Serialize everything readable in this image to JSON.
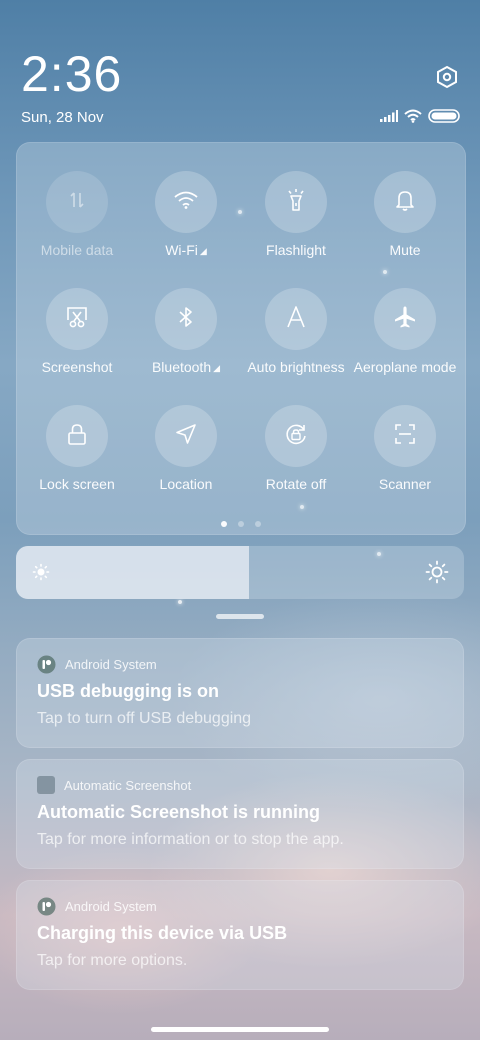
{
  "status": {
    "time": "2:36",
    "date": "Sun, 28 Nov"
  },
  "icons": {
    "settings": "settings-hexagon-icon",
    "signal": "cellular-signal-icon",
    "wifi": "wifi-status-icon",
    "battery": "battery-icon"
  },
  "quick_settings": {
    "tiles": [
      {
        "label": "Mobile data",
        "icon": "mobile-data-icon",
        "enabled": false
      },
      {
        "label": "Wi-Fi",
        "icon": "wifi-icon",
        "enabled": true
      },
      {
        "label": "Flashlight",
        "icon": "flashlight-icon",
        "enabled": true
      },
      {
        "label": "Mute",
        "icon": "bell-icon",
        "enabled": true
      },
      {
        "label": "Screenshot",
        "icon": "screenshot-scissors-icon",
        "enabled": true
      },
      {
        "label": "Bluetooth",
        "icon": "bluetooth-icon",
        "enabled": true
      },
      {
        "label": "Auto brightness",
        "icon": "auto-brightness-icon",
        "enabled": true
      },
      {
        "label": "Aeroplane mode",
        "icon": "airplane-icon",
        "enabled": true
      },
      {
        "label": "Lock screen",
        "icon": "lock-icon",
        "enabled": true
      },
      {
        "label": "Location",
        "icon": "location-arrow-icon",
        "enabled": true
      },
      {
        "label": "Rotate off",
        "icon": "rotate-lock-icon",
        "enabled": true
      },
      {
        "label": "Scanner",
        "icon": "scanner-icon",
        "enabled": true
      }
    ],
    "page_count": 3,
    "active_page": 1
  },
  "brightness": {
    "level": 0.52
  },
  "notifications": [
    {
      "app": "Android System",
      "app_icon": "android-system-icon",
      "title": "USB debugging is on",
      "text": "Tap to turn off USB debugging"
    },
    {
      "app": "Automatic Screenshot",
      "app_icon": "app-square-icon",
      "title": "Automatic Screenshot is running",
      "text": "Tap for more information or to stop the app."
    },
    {
      "app": "Android System",
      "app_icon": "android-system-icon",
      "title": "Charging this device via USB",
      "text": "Tap for more options."
    }
  ]
}
